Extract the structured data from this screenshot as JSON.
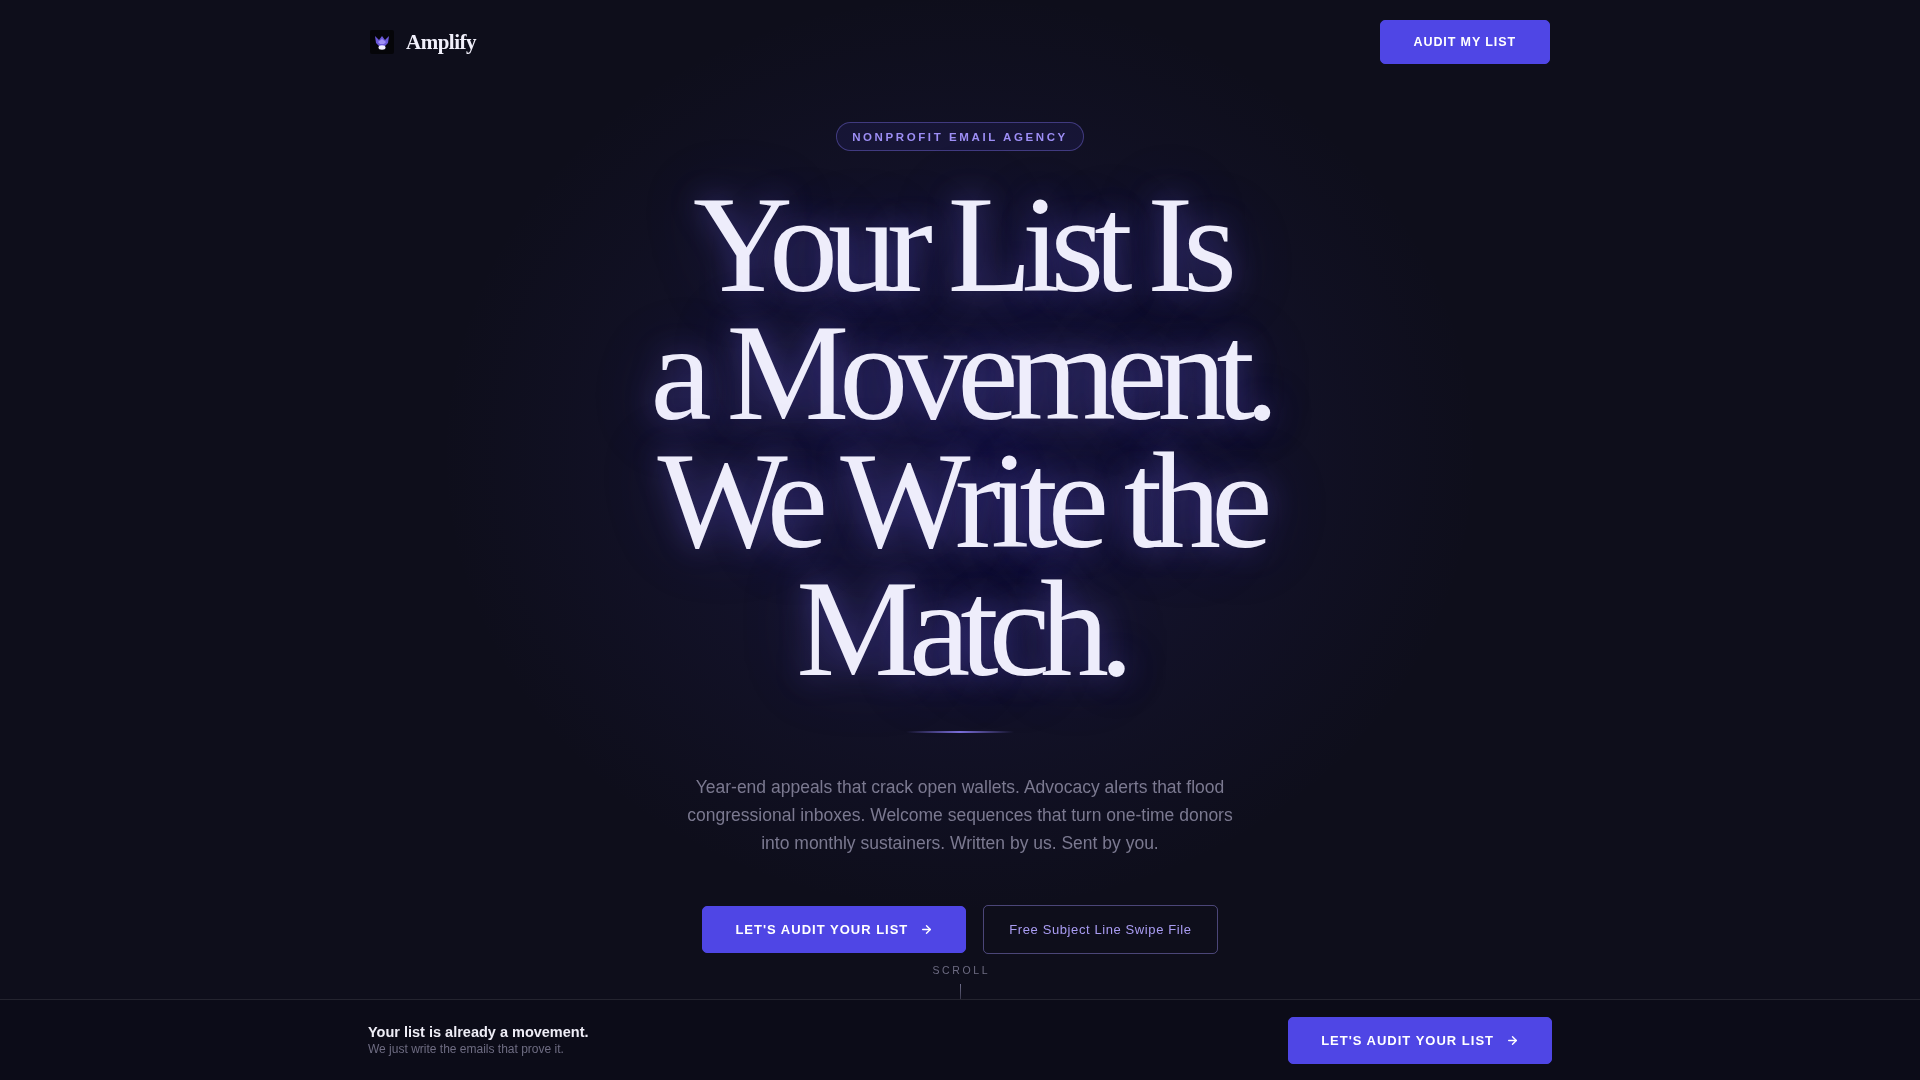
{
  "header": {
    "brand": "Amplify",
    "cta": "AUDIT MY LIST"
  },
  "hero": {
    "badge": "NONPROFIT EMAIL AGENCY",
    "headline": [
      "Your List Is",
      "a Movement.",
      "We Write the",
      "Match."
    ],
    "description": "Year-end appeals that crack open wallets. Advocacy alerts that flood congressional inboxes. Welcome sequences that turn one-time donors into monthly sustainers. Written by us. Sent by you.",
    "buttons": [
      {
        "kind": "primary",
        "label": "LET'S AUDIT YOUR LIST"
      },
      {
        "kind": "secondary",
        "label": "Free Subject Line Swipe File"
      }
    ],
    "scroll_hint": "SCROLL"
  },
  "sticky_bar": {
    "title": "Your list is already a movement.",
    "subtitle": "We just write the emails that prove it.",
    "button": "LET'S AUDIT YOUR LIST"
  }
}
